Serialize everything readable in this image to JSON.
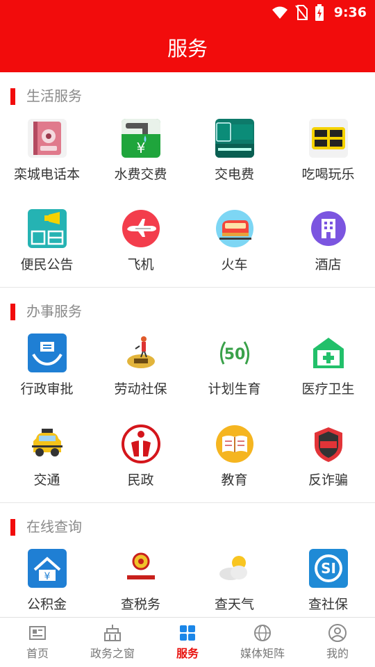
{
  "status": {
    "time": "9:36"
  },
  "header": {
    "title": "服务"
  },
  "sections": [
    {
      "title": "生活服务",
      "items": [
        {
          "label": "栾城电话本",
          "icon": "phonebook-icon"
        },
        {
          "label": "水费交费",
          "icon": "water-fee-icon"
        },
        {
          "label": "交电费",
          "icon": "electric-fee-icon"
        },
        {
          "label": "吃喝玩乐",
          "icon": "food-fun-icon"
        },
        {
          "label": "便民公告",
          "icon": "announcement-icon"
        },
        {
          "label": "飞机",
          "icon": "airplane-icon"
        },
        {
          "label": "火车",
          "icon": "train-icon"
        },
        {
          "label": "酒店",
          "icon": "hotel-icon"
        }
      ]
    },
    {
      "title": "办事服务",
      "items": [
        {
          "label": "行政审批",
          "icon": "approval-icon"
        },
        {
          "label": "劳动社保",
          "icon": "labor-insurance-icon"
        },
        {
          "label": "计划生育",
          "icon": "family-planning-icon"
        },
        {
          "label": "医疗卫生",
          "icon": "medical-icon"
        },
        {
          "label": "交通",
          "icon": "taxi-icon"
        },
        {
          "label": "民政",
          "icon": "civil-affairs-icon"
        },
        {
          "label": "教育",
          "icon": "education-icon"
        },
        {
          "label": "反诈骗",
          "icon": "anti-fraud-icon"
        }
      ]
    },
    {
      "title": "在线查询",
      "items": [
        {
          "label": "公积金",
          "icon": "housing-fund-icon"
        },
        {
          "label": "查税务",
          "icon": "tax-icon"
        },
        {
          "label": "查天气",
          "icon": "weather-icon"
        },
        {
          "label": "查社保",
          "icon": "social-security-icon"
        }
      ]
    }
  ],
  "tabs": [
    {
      "label": "首页",
      "icon": "news-icon",
      "active": false
    },
    {
      "label": "政务之窗",
      "icon": "government-building-icon",
      "active": false
    },
    {
      "label": "服务",
      "icon": "grid-icon",
      "active": true
    },
    {
      "label": "媒体矩阵",
      "icon": "globe-icon",
      "active": false
    },
    {
      "label": "我的",
      "icon": "user-icon",
      "active": false
    }
  ],
  "colors": {
    "brand": "#f20c0c",
    "active_tab": "#e8100c",
    "section_title": "#8a8a8a"
  }
}
